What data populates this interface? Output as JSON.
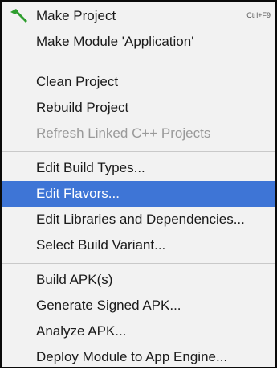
{
  "menu": {
    "items": [
      {
        "label": "Make Project",
        "shortcut": "Ctrl+F9",
        "icon": "hammer-icon"
      },
      {
        "label": "Make Module 'Application'"
      },
      {
        "label": "Clean Project"
      },
      {
        "label": "Rebuild Project"
      },
      {
        "label": "Refresh Linked C++ Projects",
        "state": "disabled"
      },
      {
        "label": "Edit Build Types..."
      },
      {
        "label": "Edit Flavors...",
        "state": "selected"
      },
      {
        "label": "Edit Libraries and Dependencies..."
      },
      {
        "label": "Select Build Variant..."
      },
      {
        "label": "Build APK(s)"
      },
      {
        "label": "Generate Signed APK..."
      },
      {
        "label": "Analyze APK..."
      },
      {
        "label": "Deploy Module to App Engine..."
      }
    ]
  },
  "colors": {
    "selection": "#3e75d6",
    "hammer_icon": "#2e9e2e",
    "disabled_text": "#9a9a9a"
  }
}
